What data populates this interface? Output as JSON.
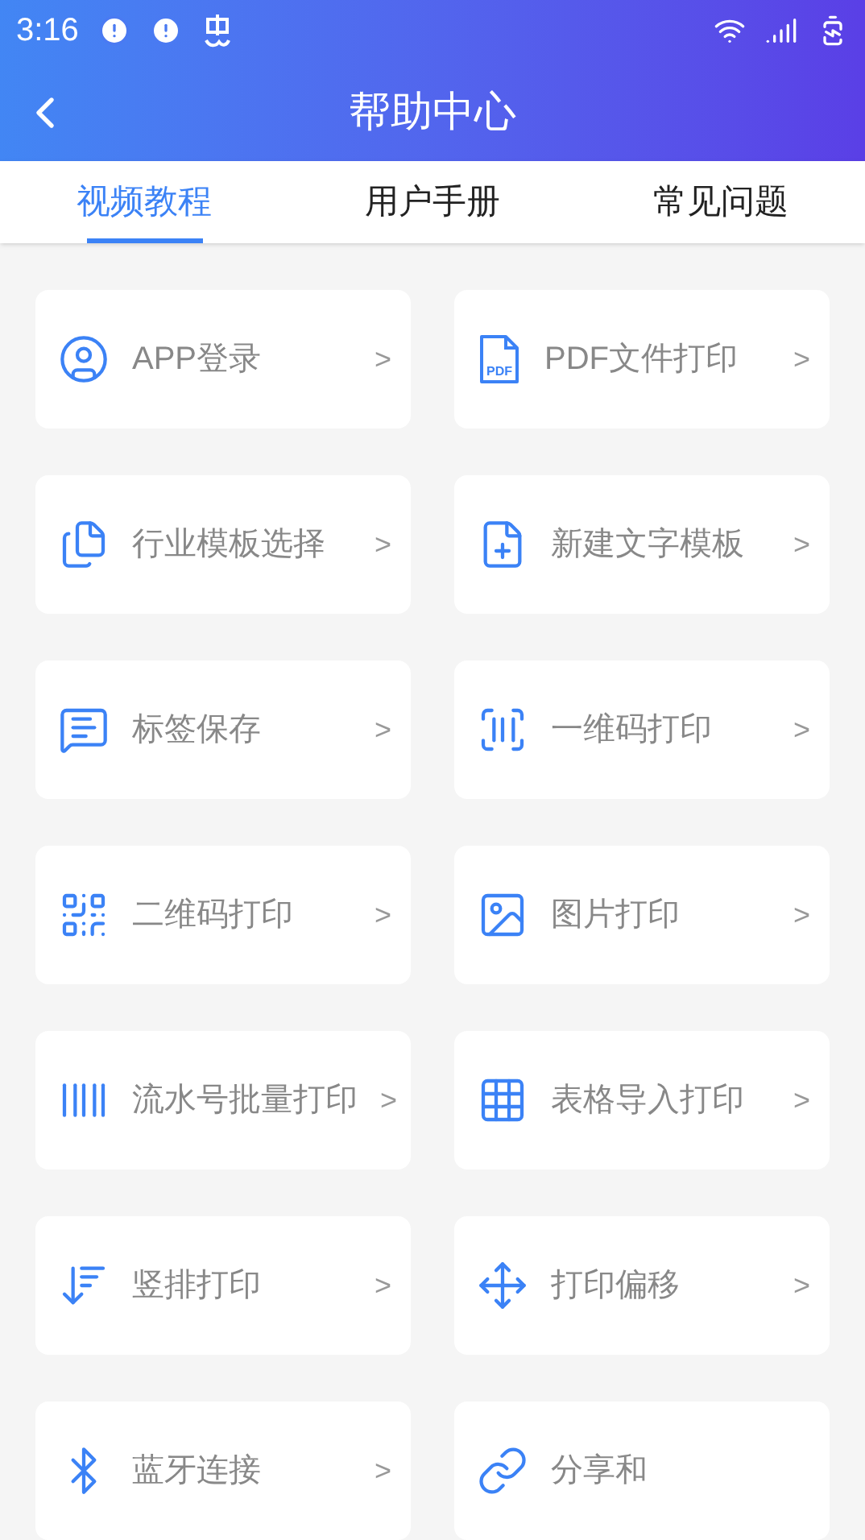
{
  "status_bar": {
    "time": "3:16"
  },
  "header": {
    "title": "帮助中心"
  },
  "tabs": [
    {
      "label": "视频教程",
      "selected": true
    },
    {
      "label": "用户手册",
      "selected": false
    },
    {
      "label": "常见问题",
      "selected": false
    }
  ],
  "items": [
    {
      "label": "APP登录",
      "chevron": ">"
    },
    {
      "label": "PDF文件打印",
      "chevron": ">",
      "icon_text": "PDF"
    },
    {
      "label": "行业模板选择",
      "chevron": ">"
    },
    {
      "label": "新建文字模板",
      "chevron": ">"
    },
    {
      "label": "标签保存",
      "chevron": ">"
    },
    {
      "label": "一维码打印",
      "chevron": ">"
    },
    {
      "label": "二维码打印",
      "chevron": ">"
    },
    {
      "label": "图片打印",
      "chevron": ">"
    },
    {
      "label": "流水号批量打印",
      "chevron": ">"
    },
    {
      "label": "表格导入打印",
      "chevron": ">"
    },
    {
      "label": "竖排打印",
      "chevron": ">"
    },
    {
      "label": "打印偏移",
      "chevron": ">"
    },
    {
      "label": "蓝牙连接",
      "chevron": ">"
    },
    {
      "label": "分享和"
    }
  ]
}
